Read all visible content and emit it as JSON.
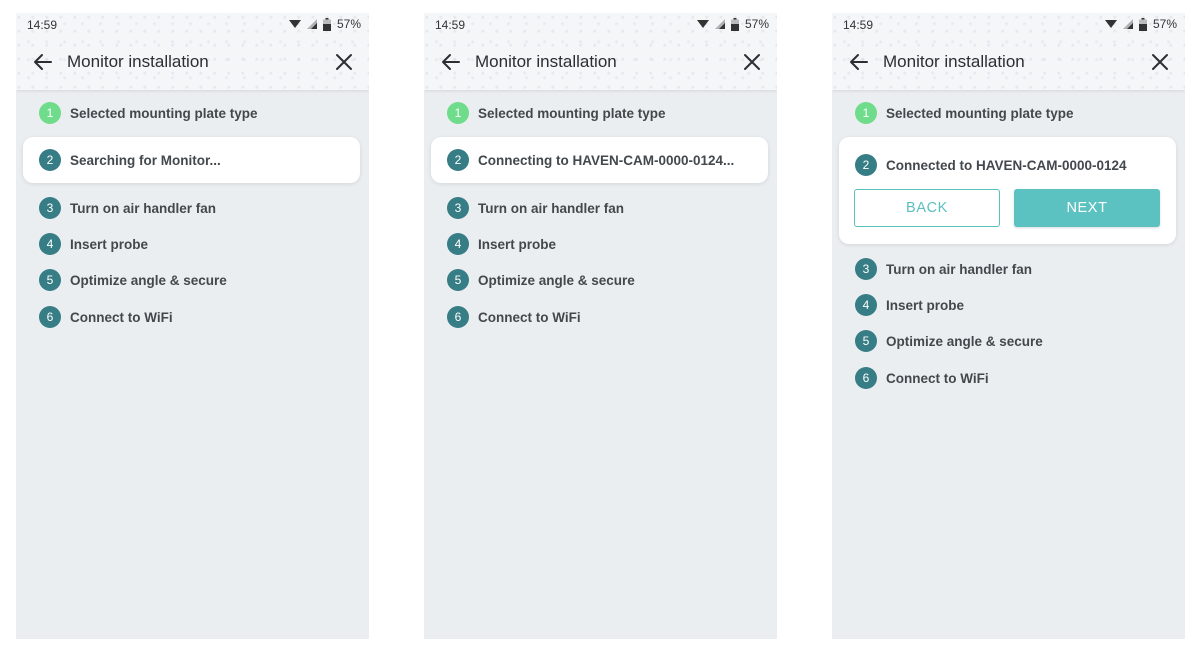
{
  "status": {
    "time": "14:59",
    "battery": "57%"
  },
  "header": {
    "title": "Monitor installation"
  },
  "steps_common": {
    "step1": {
      "num": "1",
      "label": "Selected mounting plate type"
    },
    "step3": {
      "num": "3",
      "label": "Turn on air handler fan"
    },
    "step4": {
      "num": "4",
      "label": "Insert probe"
    },
    "step5": {
      "num": "5",
      "label": "Optimize angle & secure"
    },
    "step6": {
      "num": "6",
      "label": "Connect to WiFi"
    }
  },
  "screens": [
    {
      "active_step": {
        "num": "2",
        "label": "Searching for Monitor..."
      }
    },
    {
      "active_step": {
        "num": "2",
        "label": "Connecting to HAVEN-CAM-0000-0124..."
      }
    },
    {
      "active_step": {
        "num": "2",
        "label": "Connected to HAVEN-CAM-0000-0124"
      },
      "back_label": "BACK",
      "next_label": "NEXT"
    }
  ],
  "colors": {
    "done_step": "#6fdc8b",
    "step_badge": "#367d86",
    "accent": "#5cc2c1"
  },
  "icons": {
    "back": "arrow-left-icon",
    "close": "close-icon",
    "wifi": "wifi-icon",
    "signal": "signal-icon",
    "battery": "battery-icon"
  }
}
